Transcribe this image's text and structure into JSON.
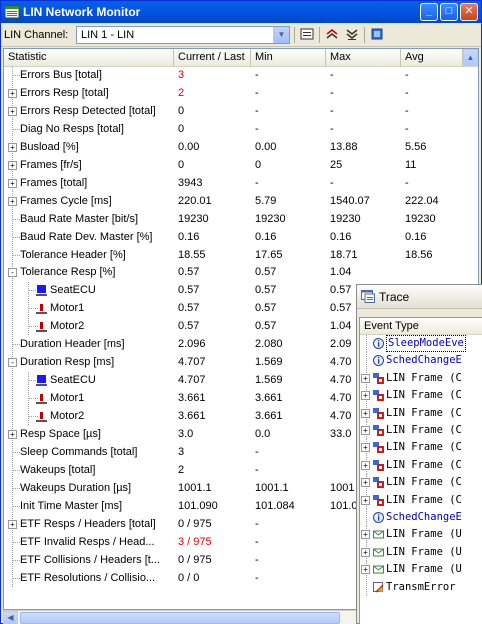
{
  "window": {
    "title": "LIN Network Monitor"
  },
  "toolbar": {
    "channel_label": "LIN Channel:",
    "channel_value": "LIN 1 - LIN"
  },
  "columns": [
    "Statistic",
    "Current / Last",
    "Min",
    "Max",
    "Avg"
  ],
  "rows": [
    {
      "label": "Errors Bus [total]",
      "cur": "3",
      "min": "-",
      "max": "-",
      "avg": "-",
      "level": 0,
      "expander": "",
      "icon": "",
      "cur_red": true
    },
    {
      "label": "Errors Resp [total]",
      "cur": "2",
      "min": "-",
      "max": "-",
      "avg": "-",
      "level": 0,
      "expander": "+",
      "icon": "",
      "cur_red": true
    },
    {
      "label": "Errors Resp Detected [total]",
      "cur": "0",
      "min": "-",
      "max": "-",
      "avg": "-",
      "level": 0,
      "expander": "+",
      "icon": "",
      "cur_red": false
    },
    {
      "label": "Diag No Resps [total]",
      "cur": "0",
      "min": "-",
      "max": "-",
      "avg": "-",
      "level": 0,
      "expander": "",
      "icon": "",
      "cur_red": false
    },
    {
      "label": "Busload [%]",
      "cur": "0.00",
      "min": "0.00",
      "max": "13.88",
      "avg": "5.56",
      "level": 0,
      "expander": "+",
      "icon": "",
      "cur_red": false
    },
    {
      "label": "Frames [fr/s]",
      "cur": "0",
      "min": "0",
      "max": "25",
      "avg": "11",
      "level": 0,
      "expander": "+",
      "icon": "",
      "cur_red": false
    },
    {
      "label": "Frames [total]",
      "cur": "3943",
      "min": "-",
      "max": "-",
      "avg": "-",
      "level": 0,
      "expander": "+",
      "icon": "",
      "cur_red": false
    },
    {
      "label": "Frames Cycle [ms]",
      "cur": "220.01",
      "min": "5.79",
      "max": "1540.07",
      "avg": "222.04",
      "level": 0,
      "expander": "+",
      "icon": "",
      "cur_red": false
    },
    {
      "label": "Baud Rate Master [bit/s]",
      "cur": "19230",
      "min": "19230",
      "max": "19230",
      "avg": "19230",
      "level": 0,
      "expander": "",
      "icon": "",
      "cur_red": false
    },
    {
      "label": "Baud Rate Dev. Master [%]",
      "cur": "0.16",
      "min": "0.16",
      "max": "0.16",
      "avg": "0.16",
      "level": 0,
      "expander": "",
      "icon": "",
      "cur_red": false
    },
    {
      "label": "Tolerance Header [%]",
      "cur": "18.55",
      "min": "17.65",
      "max": "18.71",
      "avg": "18.56",
      "level": 0,
      "expander": "",
      "icon": "",
      "cur_red": false
    },
    {
      "label": "Tolerance Resp [%]",
      "cur": "0.57",
      "min": "0.57",
      "max": "1.04",
      "avg": "",
      "level": 0,
      "expander": "-",
      "icon": "",
      "cur_red": false
    },
    {
      "label": "SeatECU",
      "cur": "0.57",
      "min": "0.57",
      "max": "0.57",
      "avg": "",
      "level": 1,
      "expander": "",
      "icon": "master",
      "cur_red": false
    },
    {
      "label": "Motor1",
      "cur": "0.57",
      "min": "0.57",
      "max": "0.57",
      "avg": "",
      "level": 1,
      "expander": "",
      "icon": "slave",
      "cur_red": false
    },
    {
      "label": "Motor2",
      "cur": "0.57",
      "min": "0.57",
      "max": "1.04",
      "avg": "",
      "level": 1,
      "expander": "",
      "icon": "slave",
      "cur_red": false
    },
    {
      "label": "Duration Header [ms]",
      "cur": "2.096",
      "min": "2.080",
      "max": "2.09",
      "avg": "",
      "level": 0,
      "expander": "",
      "icon": "",
      "cur_red": false
    },
    {
      "label": "Duration Resp [ms]",
      "cur": "4.707",
      "min": "1.569",
      "max": "4.70",
      "avg": "",
      "level": 0,
      "expander": "-",
      "icon": "",
      "cur_red": false
    },
    {
      "label": "SeatECU",
      "cur": "4.707",
      "min": "1.569",
      "max": "4.70",
      "avg": "",
      "level": 1,
      "expander": "",
      "icon": "master",
      "cur_red": false
    },
    {
      "label": "Motor1",
      "cur": "3.661",
      "min": "3.661",
      "max": "4.70",
      "avg": "",
      "level": 1,
      "expander": "",
      "icon": "slave",
      "cur_red": false
    },
    {
      "label": "Motor2",
      "cur": "3.661",
      "min": "3.661",
      "max": "4.70",
      "avg": "",
      "level": 1,
      "expander": "",
      "icon": "slave",
      "cur_red": false
    },
    {
      "label": "Resp Space [µs]",
      "cur": "3.0",
      "min": "0.0",
      "max": "33.0",
      "avg": "",
      "level": 0,
      "expander": "+",
      "icon": "",
      "cur_red": false
    },
    {
      "label": "Sleep Commands [total]",
      "cur": "3",
      "min": "-",
      "max": "",
      "avg": "",
      "level": 0,
      "expander": "",
      "icon": "",
      "cur_red": false
    },
    {
      "label": "Wakeups [total]",
      "cur": "2",
      "min": "-",
      "max": "",
      "avg": "",
      "level": 0,
      "expander": "",
      "icon": "",
      "cur_red": false
    },
    {
      "label": "Wakeups Duration [µs]",
      "cur": "1001.1",
      "min": "1001.1",
      "max": "1001",
      "avg": "",
      "level": 0,
      "expander": "",
      "icon": "",
      "cur_red": false
    },
    {
      "label": "Init Time Master [ms]",
      "cur": "101.090",
      "min": "101.084",
      "max": "101.0",
      "avg": "",
      "level": 0,
      "expander": "",
      "icon": "",
      "cur_red": false
    },
    {
      "label": "ETF Resps / Headers [total]",
      "cur": "0 / 975",
      "min": "-",
      "max": "",
      "avg": "",
      "level": 0,
      "expander": "+",
      "icon": "",
      "cur_red": false
    },
    {
      "label": "ETF Invalid Resps / Head...",
      "cur": "3 / 975",
      "min": "-",
      "max": "",
      "avg": "",
      "level": 0,
      "expander": "",
      "icon": "",
      "cur_red": true
    },
    {
      "label": "ETF Collisions / Headers [t...",
      "cur": "0 / 975",
      "min": "-",
      "max": "",
      "avg": "",
      "level": 0,
      "expander": "",
      "icon": "",
      "cur_red": false
    },
    {
      "label": "ETF Resolutions / Collisio...",
      "cur": "0 / 0",
      "min": "-",
      "max": "",
      "avg": "",
      "level": 0,
      "expander": "",
      "icon": "",
      "cur_red": false
    }
  ],
  "trace": {
    "title": "Trace",
    "column": "Event Type",
    "rows": [
      {
        "text": "SleepModeEve",
        "icon": "info",
        "expander": "",
        "event": true,
        "selected": true
      },
      {
        "text": "SchedChangeE",
        "icon": "info",
        "expander": "",
        "event": true,
        "selected": false
      },
      {
        "text": "LIN Frame (C",
        "icon": "frame",
        "expander": "+",
        "event": false,
        "selected": false
      },
      {
        "text": "LIN Frame (C",
        "icon": "frame",
        "expander": "+",
        "event": false,
        "selected": false
      },
      {
        "text": "LIN Frame (C",
        "icon": "frame",
        "expander": "+",
        "event": false,
        "selected": false
      },
      {
        "text": "LIN Frame (C",
        "icon": "frame",
        "expander": "+",
        "event": false,
        "selected": false
      },
      {
        "text": "LIN Frame (C",
        "icon": "frame",
        "expander": "+",
        "event": false,
        "selected": false
      },
      {
        "text": "LIN Frame (C",
        "icon": "frame",
        "expander": "+",
        "event": false,
        "selected": false
      },
      {
        "text": "LIN Frame (C",
        "icon": "frame",
        "expander": "+",
        "event": false,
        "selected": false
      },
      {
        "text": "LIN Frame (C",
        "icon": "frame",
        "expander": "+",
        "event": false,
        "selected": false
      },
      {
        "text": "SchedChangeE",
        "icon": "info",
        "expander": "",
        "event": true,
        "selected": false
      },
      {
        "text": "LIN Frame (U",
        "icon": "envelope",
        "expander": "+",
        "event": false,
        "selected": false
      },
      {
        "text": "LIN Frame (U",
        "icon": "envelope",
        "expander": "+",
        "event": false,
        "selected": false
      },
      {
        "text": "LIN Frame (U",
        "icon": "envelope",
        "expander": "+",
        "event": false,
        "selected": false
      },
      {
        "text": "TransmError",
        "icon": "error",
        "expander": "",
        "event": false,
        "selected": false
      }
    ]
  },
  "colors": {
    "red_value": "#e00000",
    "event_text": "#0000c0",
    "master_node": "#1a1aff",
    "slave_node": "#c00000"
  }
}
